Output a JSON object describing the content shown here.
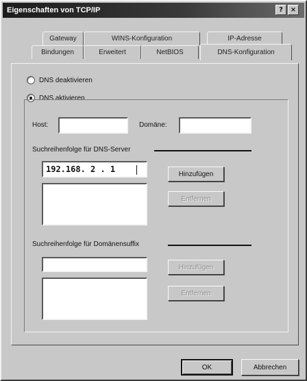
{
  "window": {
    "title": "Eigenschaften von TCP/IP",
    "help_btn": "?",
    "close_btn": "×"
  },
  "tabs_back": [
    "Gateway",
    "WINS-Konfiguration",
    "IP-Adresse"
  ],
  "tabs_front": [
    "Bindungen",
    "Erweitert",
    "NetBIOS",
    "DNS-Konfiguration"
  ],
  "dns": {
    "disable_label": "DNS deaktivieren",
    "enable_label": "DNS aktivieren",
    "selected": "enable",
    "host_label": "Host:",
    "host_value": "",
    "domain_label": "Domäne:",
    "domain_value": "",
    "server_section": "Suchreihenfolge für DNS-Server",
    "server_input": "192.168. 2 . 1",
    "server_add": "Hinzufügen",
    "server_remove": "Entfernen",
    "suffix_section": "Suchreihenfolge für Domänensuffix",
    "suffix_input": "",
    "suffix_add": "Hinzufügen",
    "suffix_remove": "Entfernen"
  },
  "footer": {
    "ok": "OK",
    "cancel": "Abbrechen"
  }
}
